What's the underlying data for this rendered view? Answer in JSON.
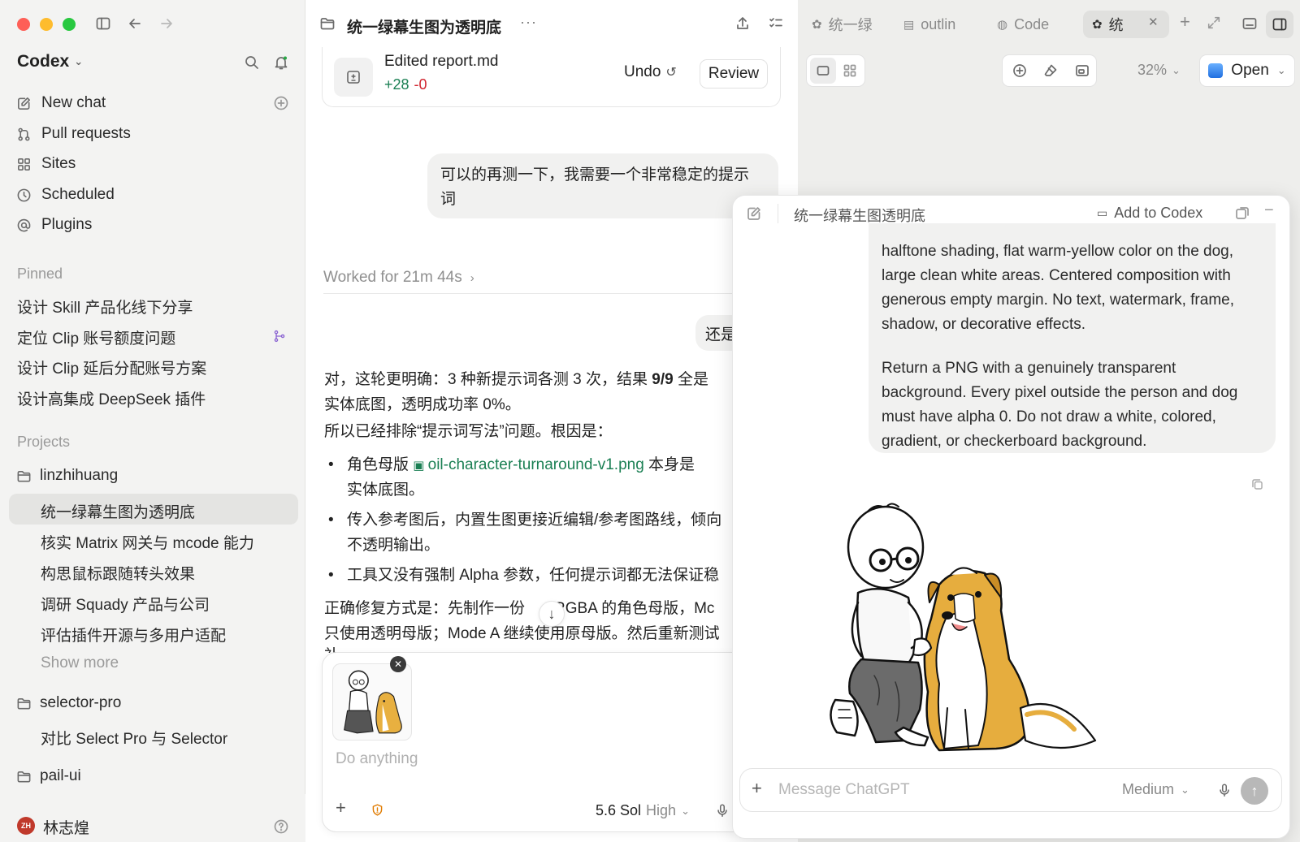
{
  "sidebar": {
    "app_name": "Codex",
    "nav": [
      {
        "label": "New chat",
        "icon": "compose-icon"
      },
      {
        "label": "Pull requests",
        "icon": "pull-request-icon"
      },
      {
        "label": "Sites",
        "icon": "grid-icon"
      },
      {
        "label": "Scheduled",
        "icon": "clock-icon"
      },
      {
        "label": "Plugins",
        "icon": "at-icon"
      }
    ],
    "pinned_heading": "Pinned",
    "pinned": [
      "设计 Skill 产品化线下分享",
      "定位 Clip 账号额度问题",
      "设计 Clip 延后分配账号方案",
      "设计高集成 DeepSeek 插件"
    ],
    "projects_heading": "Projects",
    "projects": [
      {
        "name": "linzhihuang",
        "chats": [
          "统一绿幕生图为透明底",
          "核实 Matrix 网关与 mcode 能力",
          "构思鼠标跟随转头效果",
          "调研 Squady 产品与公司",
          "评估插件开源与多用户适配"
        ],
        "show_more": "Show more"
      },
      {
        "name": "selector-pro",
        "chats": [
          "对比 Select Pro 与 Selector"
        ]
      },
      {
        "name": "pail-ui",
        "chats": []
      }
    ],
    "user": {
      "initials": "ZH",
      "name": "林志煌"
    }
  },
  "center": {
    "title": "统一绿幕生图为透明底",
    "edit_card": {
      "title": "Edited report.md",
      "added": "+28",
      "removed": "-0",
      "undo": "Undo",
      "review": "Review"
    },
    "user_msg_1": [
      "可以的再测一下，我需要一个非常稳定的提示",
      "词"
    ],
    "worked": "Worked for 21m 44s",
    "user_msg_2": "还是",
    "reply": {
      "p1a": "对，这轮更明确：3 种新提示词各测 3 次，结果 ",
      "p1b": "9/9",
      "p1c": " 全是",
      "p1d": "实体底图，透明成功率 0%。",
      "p2": "所以已经排除“提示词写法”问题。根因是：",
      "b1a": "角色母版 ",
      "b1link": "oil-character-turnaround-v1.png",
      "b1b": " 本身是",
      "b1c": "实体底图。",
      "b2a": "传入参考图后，内置生图更接近编辑/参考图路线，倾向",
      "b2b": "不透明输出。",
      "b3": "工具又没有强制 Alpha 参数，任何提示词都无法保证稳",
      "p3a": "正确修复方式是：先制作一份",
      "p3b": "RGBA 的角色母版，Mc",
      "p4": "只使用透明母版；Mode A 继续使用原母版。然后重新测试",
      "p5": "补"
    },
    "composer": {
      "placeholder": "Do anything",
      "model": "5.6 Sol",
      "effort": "High"
    }
  },
  "right": {
    "tabs": [
      "统一绿",
      "outlin",
      "Code",
      "统"
    ],
    "zoom": "32%",
    "open_label": "Open",
    "popup": {
      "title": "统一绿幕生图透明底",
      "add_to_codex": "Add to Codex",
      "prompt_p1": [
        "halftone shading, flat warm-yellow color on the dog,",
        "large clean white areas. Centered composition with",
        "generous empty margin. No text, watermark, frame,",
        "shadow, or decorative effects."
      ],
      "prompt_p2": [
        "Return a PNG with a genuinely transparent",
        "background. Every pixel outside the person and dog",
        "must have alpha 0. Do not draw a white, colored,",
        "gradient, or checkerboard background."
      ],
      "composer_placeholder": "Message ChatGPT",
      "effort": "Medium"
    }
  },
  "colors": {
    "accent_green": "#1a7f53",
    "removed_red": "#d1242f",
    "selected_bg": "#e4e4e2"
  }
}
